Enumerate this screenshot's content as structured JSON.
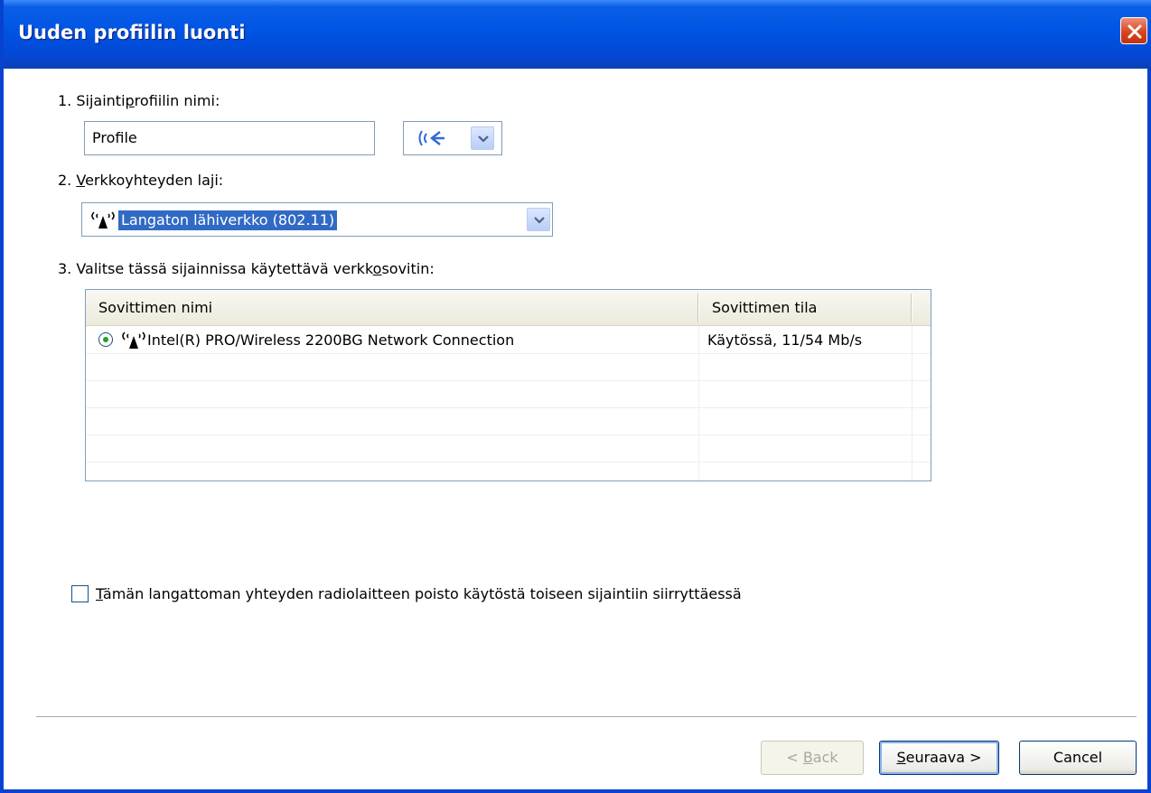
{
  "window": {
    "title": "Uuden profiilin luonti"
  },
  "step1": {
    "label_pre": "1. Sijainti",
    "label_key": "p",
    "label_post": "rofiilin nimi:",
    "input_value": "Profile",
    "icon": "broadcast-icon"
  },
  "step2": {
    "label_pre": "2. ",
    "label_key": "V",
    "label_post": "erkkoyhteyden laji:",
    "selected": "Langaton lähiverkko (802.11)",
    "icon": "wireless-antenna-icon"
  },
  "step3": {
    "label_pre": "3. Valitse tässä sijainnissa käytettävä verkk",
    "label_key": "o",
    "label_post": "sovitin:",
    "columns": [
      "Sovittimen nimi",
      "Sovittimen tila"
    ],
    "rows": [
      {
        "name": "Intel(R) PRO/Wireless 2200BG Network Connection",
        "status": "Käytössä, 11/54 Mb/s",
        "selected": true
      }
    ]
  },
  "option": {
    "key": "T",
    "label_post": "ämän langattoman yhteyden radiolaitteen poisto käytöstä toiseen sijaintiin siirryttäessä",
    "checked": false
  },
  "buttons": {
    "back_pre": "< ",
    "back_key": "B",
    "back_post": "ack",
    "next_key": "S",
    "next_post": "euraava >",
    "cancel": "Cancel"
  },
  "colors": {
    "titlebar": "#0054e3",
    "selection": "#316ac5",
    "border": "#7f9db9"
  }
}
